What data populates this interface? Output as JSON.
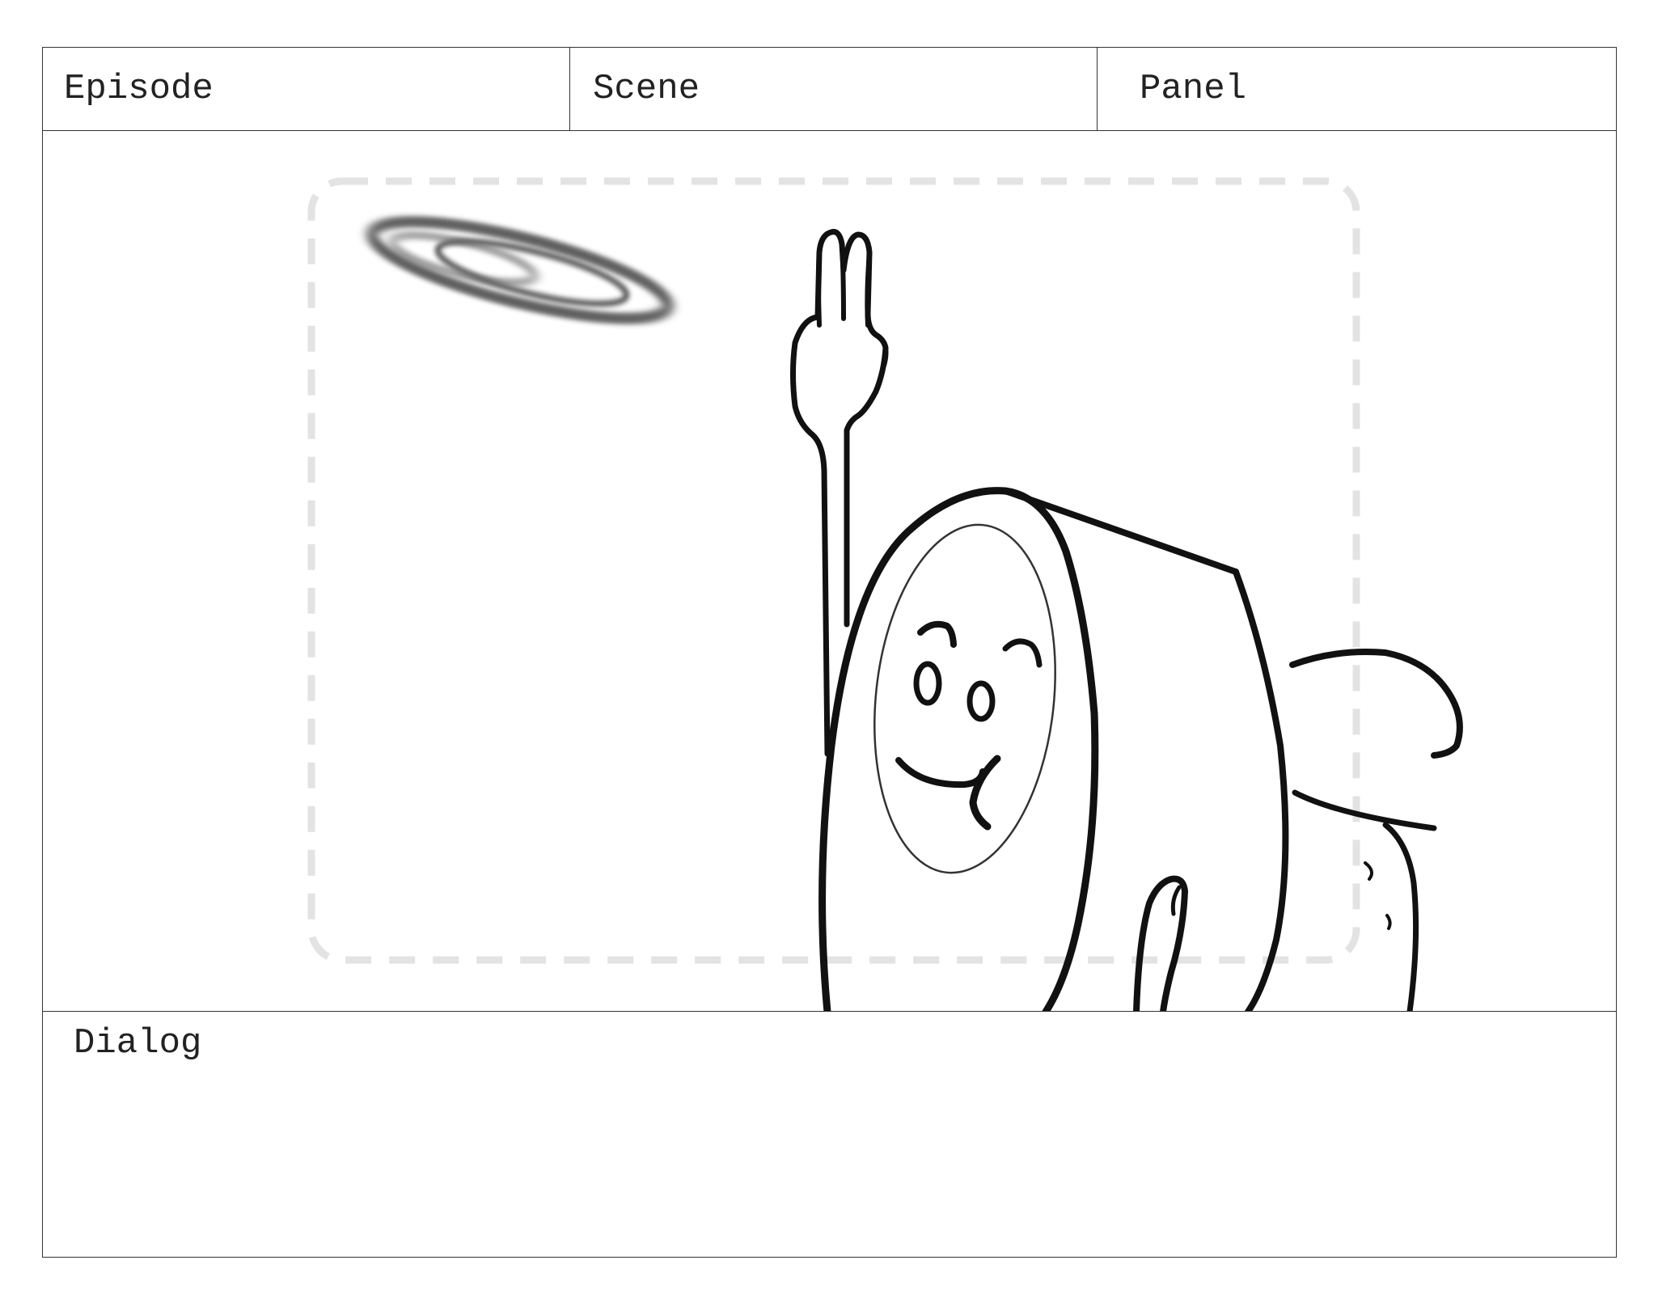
{
  "header": {
    "episode_label": "Episode",
    "scene_label": "Scene",
    "panel_label": "Panel"
  },
  "dialog": {
    "label": "Dialog"
  }
}
